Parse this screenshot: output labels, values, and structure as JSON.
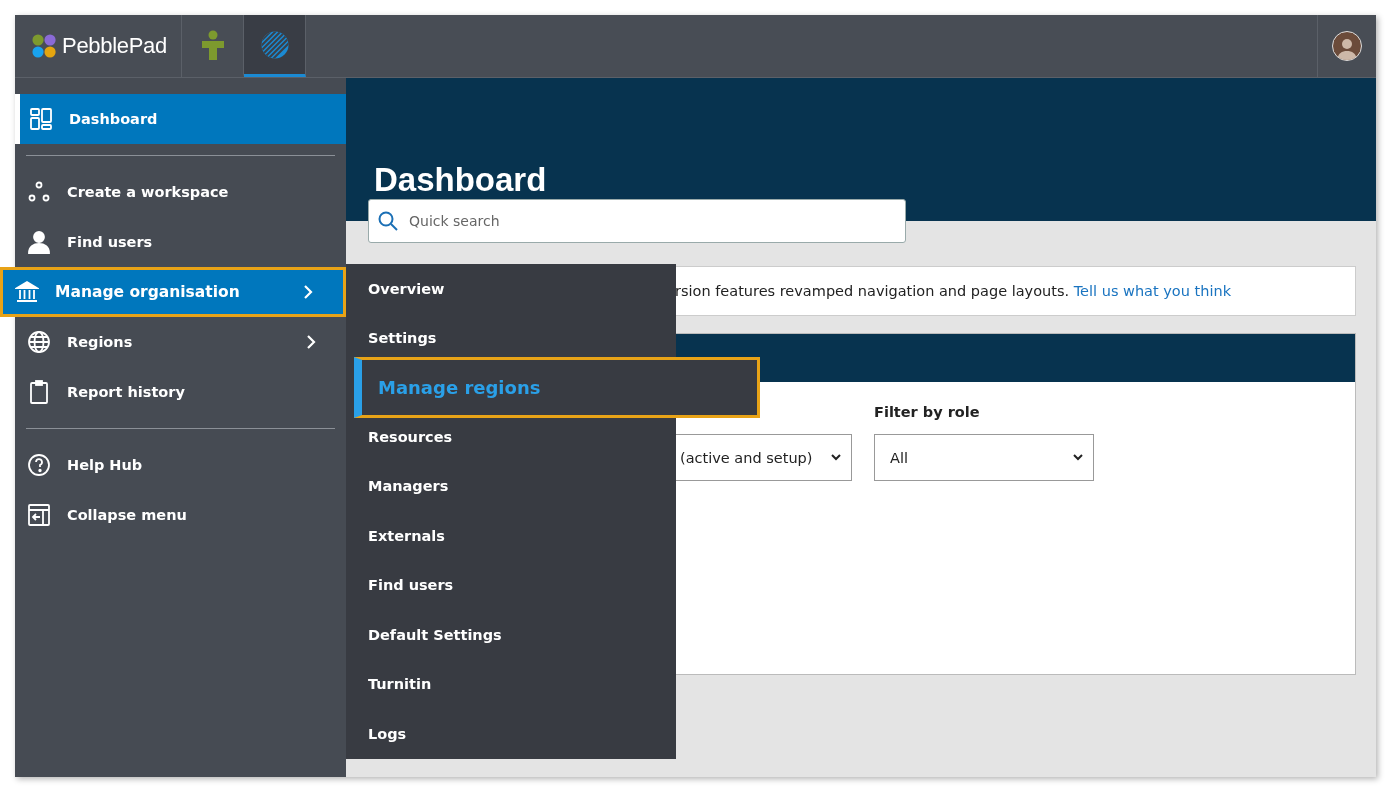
{
  "top_bar": {
    "logo": "PebblePad",
    "apps": [
      {
        "selected": false
      },
      {
        "selected": true
      }
    ]
  },
  "sidebar": {
    "groups": [
      [
        {
          "label": "Dashboard",
          "selected": true,
          "expanded": false,
          "submenu": false
        }
      ],
      [
        {
          "label": "Create a workspace",
          "selected": false,
          "expanded": false,
          "submenu": false
        },
        {
          "label": "Find users",
          "selected": false,
          "expanded": false,
          "submenu": false
        },
        {
          "label": "Manage organisation",
          "selected": false,
          "expanded": true,
          "submenu": true
        },
        {
          "label": "Regions",
          "selected": false,
          "expanded": false,
          "submenu": true
        },
        {
          "label": "Report history",
          "selected": false,
          "expanded": false,
          "submenu": false
        }
      ],
      [
        {
          "label": "Help Hub",
          "selected": false,
          "expanded": false,
          "submenu": false
        },
        {
          "label": "Collapse menu",
          "selected": false,
          "expanded": false,
          "submenu": false
        }
      ]
    ]
  },
  "flyout": [
    {
      "label": "Overview",
      "selected": false
    },
    {
      "label": "Settings",
      "selected": false
    },
    {
      "label": "Manage regions",
      "selected": true
    },
    {
      "label": "Resources",
      "selected": false
    },
    {
      "label": "Managers",
      "selected": false
    },
    {
      "label": "Externals",
      "selected": false
    },
    {
      "label": "Find users",
      "selected": false
    },
    {
      "label": "Default Settings",
      "selected": false
    },
    {
      "label": "Turnitin",
      "selected": false
    },
    {
      "label": "Logs",
      "selected": false
    }
  ],
  "page": {
    "title": "Dashboard",
    "search": {
      "placeholder": "Quick search"
    },
    "banner": {
      "text": "rsion features revamped navigation and page layouts.",
      "link": "Tell us what you think"
    },
    "filters": [
      {
        "value": "(active and setup)"
      },
      {
        "label": "Filter by role",
        "value": "All"
      }
    ]
  }
}
